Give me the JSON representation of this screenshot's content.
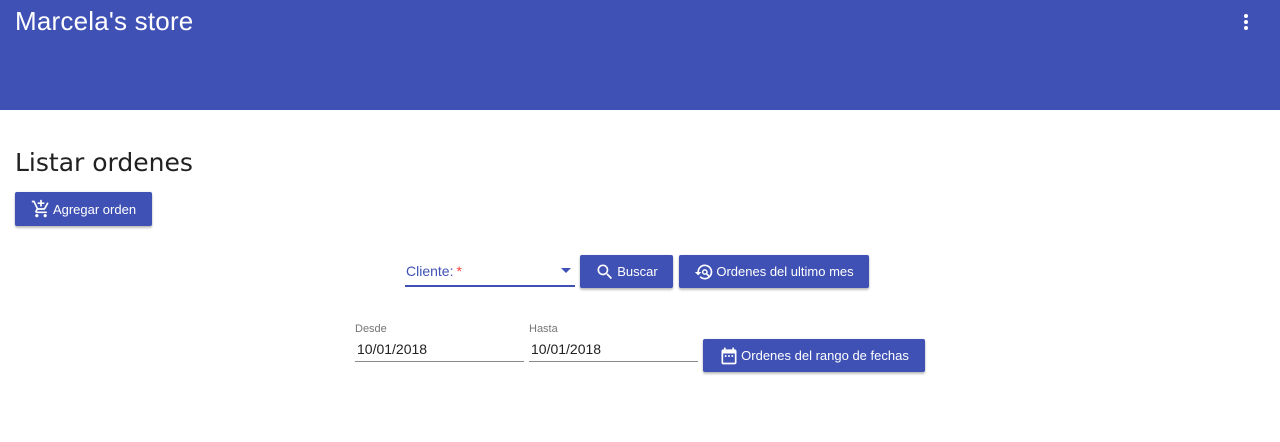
{
  "app": {
    "title": "Marcela's store",
    "menu_icon": "more-vert-icon",
    "primary_color": "#3f51b5"
  },
  "page": {
    "title": "Listar ordenes"
  },
  "actions": {
    "add_order_label": "Agregar orden",
    "add_order_icon": "add-shopping-cart-icon"
  },
  "filters": {
    "client_label": "Cliente:",
    "client_required_mark": "*",
    "search_label": "Buscar",
    "search_icon": "search-icon",
    "last_month_label": "Ordenes del ultimo mes",
    "last_month_icon": "restore-search-icon",
    "from_label": "Desde",
    "from_value": "10/01/2018",
    "to_label": "Hasta",
    "to_value": "10/01/2018",
    "range_label": "Ordenes del rango de fechas",
    "range_icon": "calendar-icon"
  }
}
